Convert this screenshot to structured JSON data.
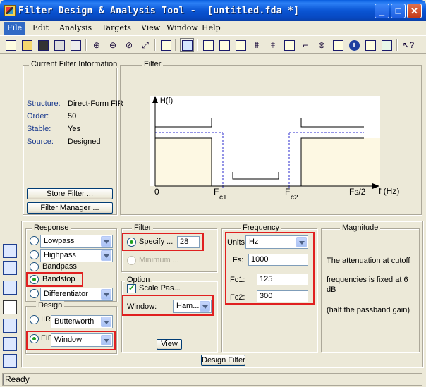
{
  "window": {
    "title": "Filter Design & Analysis Tool -  [untitled.fda *]",
    "controls": [
      "_",
      "□",
      "✕"
    ]
  },
  "menu": [
    "File",
    "Edit",
    "Analysis",
    "Targets",
    "View",
    "Window",
    "Help"
  ],
  "toolbar": {
    "icons": [
      "new-icon",
      "open-icon",
      "save-icon",
      "print-icon",
      "print-preview-icon",
      "zoom-in-icon",
      "zoom-out-icon",
      "zoom-x-icon",
      "full-view-icon",
      "new-window-icon",
      "design-filter-icon",
      "magnitude-response-icon",
      "phase-response-icon",
      "magnitude-phase-icon",
      "group-delay-icon",
      "phase-delay-icon",
      "impulse-response-icon",
      "step-response-icon",
      "pole-zero-icon",
      "filter-coefficients-icon",
      "filter-info-icon",
      "magnitude-estimate-icon",
      "round-off-noise-icon",
      "whats-this-icon"
    ]
  },
  "current_info": {
    "title": "Current Filter Information",
    "rows": [
      {
        "label": "Structure:",
        "value": "Direct-Form FIR"
      },
      {
        "label": "Order:",
        "value": "50"
      },
      {
        "label": "Stable:",
        "value": "Yes"
      },
      {
        "label": "Source:",
        "value": "Designed"
      }
    ],
    "store_button": "Store Filter ...",
    "manager_button": "Filter Manager ..."
  },
  "filter_panel": {
    "title": "Filter",
    "y_label": "|H(f)|",
    "x_label": "f (Hz)",
    "ticks": {
      "zero": "0",
      "fc1_main": "F",
      "fc1_sub": "c1",
      "fc2_main": "F",
      "fc2_sub": "c2",
      "fs2": "Fs/2"
    }
  },
  "response": {
    "title": "Response",
    "lowpass": "Lowpass",
    "highpass": "Highpass",
    "bandpass": "Bandpass",
    "bandstop": "Bandstop",
    "differentiator": "Differentiator"
  },
  "design": {
    "title": "Design",
    "iir_label": "IIR",
    "iir_method": "Butterworth",
    "fir_label": "FIR",
    "fir_method": "Window"
  },
  "filter_order": {
    "title": "Filter",
    "specify_label": "Specify ...",
    "specify_value": "28",
    "minimum_label": "Minimum ..."
  },
  "options": {
    "title": "Option",
    "scale_label": "Scale Pas...",
    "window_label": "Window:",
    "window_value": "Ham...",
    "view_button": "View"
  },
  "frequency": {
    "title": "Frequency",
    "units_label": "Units:",
    "units_value": "Hz",
    "fs_label": "Fs:",
    "fs_value": "1000",
    "fc1_label": "Fc1:",
    "fc1_value": "125",
    "fc2_label": "Fc2:",
    "fc2_value": "300"
  },
  "magnitude": {
    "title": "Magnitude",
    "line1": "The attenuation at cutoff",
    "line2": "frequencies is fixed at 6",
    "line3": "dB",
    "line4": "(half the passband gain)"
  },
  "design_button": "Design Filter",
  "status": "Ready"
}
